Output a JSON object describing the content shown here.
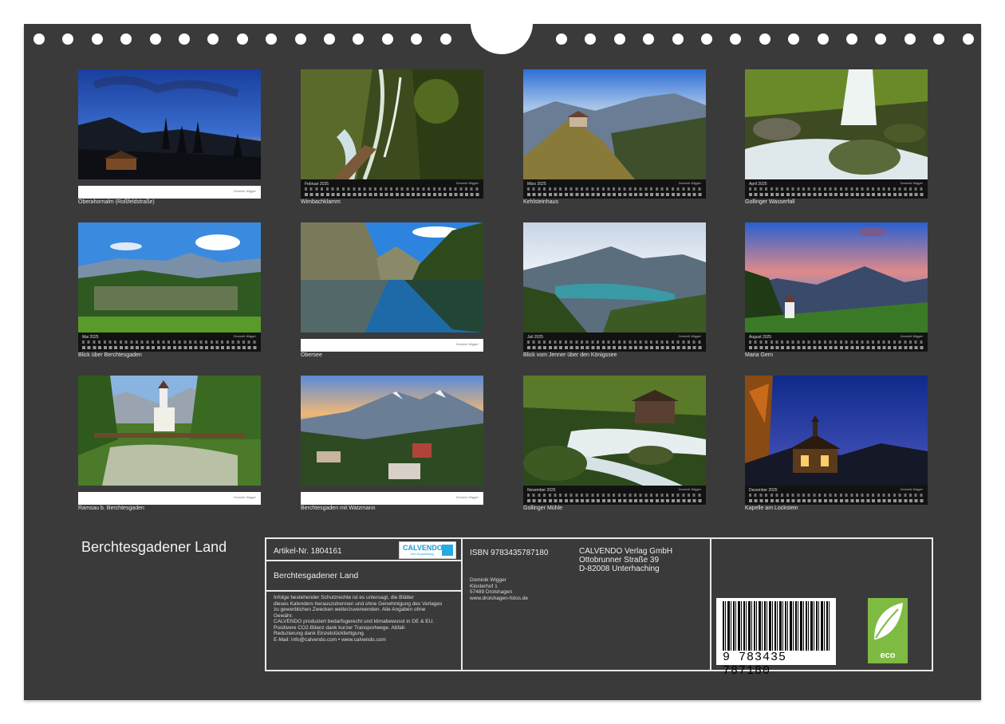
{
  "calendar_title": "Berchtesgadener Land",
  "months": [
    {
      "month": "",
      "caption": "Oberahornalm (Roßfeldstraße)",
      "credit": "Dominik Wigger"
    },
    {
      "month": "Februar 2025",
      "caption": "Wimbachklamm",
      "credit": "Dominik Wigger"
    },
    {
      "month": "März 2025",
      "caption": "Kehlsteinhaus",
      "credit": "Dominik Wigger"
    },
    {
      "month": "April 2025",
      "caption": "Gollinger Wasserfall",
      "credit": "Dominik Wigger"
    },
    {
      "month": "Mai 2025",
      "caption": "Blick über Berchtesgaden",
      "credit": "Dominik Wigger"
    },
    {
      "month": "",
      "caption": "Obersee",
      "credit": "Dominik Wigger"
    },
    {
      "month": "Juli 2025",
      "caption": "Blick vom Jenner über den Königssee",
      "credit": "Dominik Wigger"
    },
    {
      "month": "August 2025",
      "caption": "Maria Gern",
      "credit": "Dominik Wigger"
    },
    {
      "month": "",
      "caption": "Ramsau b. Berchtesgaden",
      "credit": "Dominik Wigger"
    },
    {
      "month": "",
      "caption": "Berchtesgaden mit Watzmann",
      "credit": "Dominik Wigger"
    },
    {
      "month": "November 2025",
      "caption": "Gollinger Mühle",
      "credit": "Dominik Wigger"
    },
    {
      "month": "Dezember 2025",
      "caption": "Kapelle am Lockstein",
      "credit": "Dominik Wigger"
    }
  ],
  "info": {
    "article": "Artikel-Nr. 1804161",
    "logo_text": "CALVENDO",
    "logo_sub": "Der Kunstverlag",
    "product_title": "Berchtesgadener Land",
    "legal_1": "Infolge bestehender Schutzrechte ist es untersagt, die Blätter",
    "legal_2": "dieses Kalenders herauszutrennen und ohne Genehmigung des Verlages",
    "legal_3": "zu gewerblichen Zwecken weiterzuverwenden. Alle Angaben ohne",
    "legal_4": "Gewähr.",
    "legal_5": "CALVENDO produziert bedarfsgerecht und klimabewusst in DE & EU.",
    "legal_6": "Positivere CO2-Bilanz dank kurzer Transportwege. Abfall-",
    "legal_7": "Reduzierung dank Einzelstückfertigung.",
    "legal_8": "E-Mail: info@calvendo.com • www.calvendo.com",
    "isbn": "ISBN 9783435787180",
    "author_1": "Dominik Wigger",
    "author_2": "Klosterhof 1",
    "author_3": "57489 Drolshagen",
    "author_4": "www.drolshagen-fotos.de",
    "publisher_1": "CALVENDO Verlag GmbH",
    "publisher_2": "Ottobrunner Straße 39",
    "publisher_3": "D-82008 Unterhaching",
    "barcode_number": "9 783435 787180",
    "eco_label": "eco"
  }
}
